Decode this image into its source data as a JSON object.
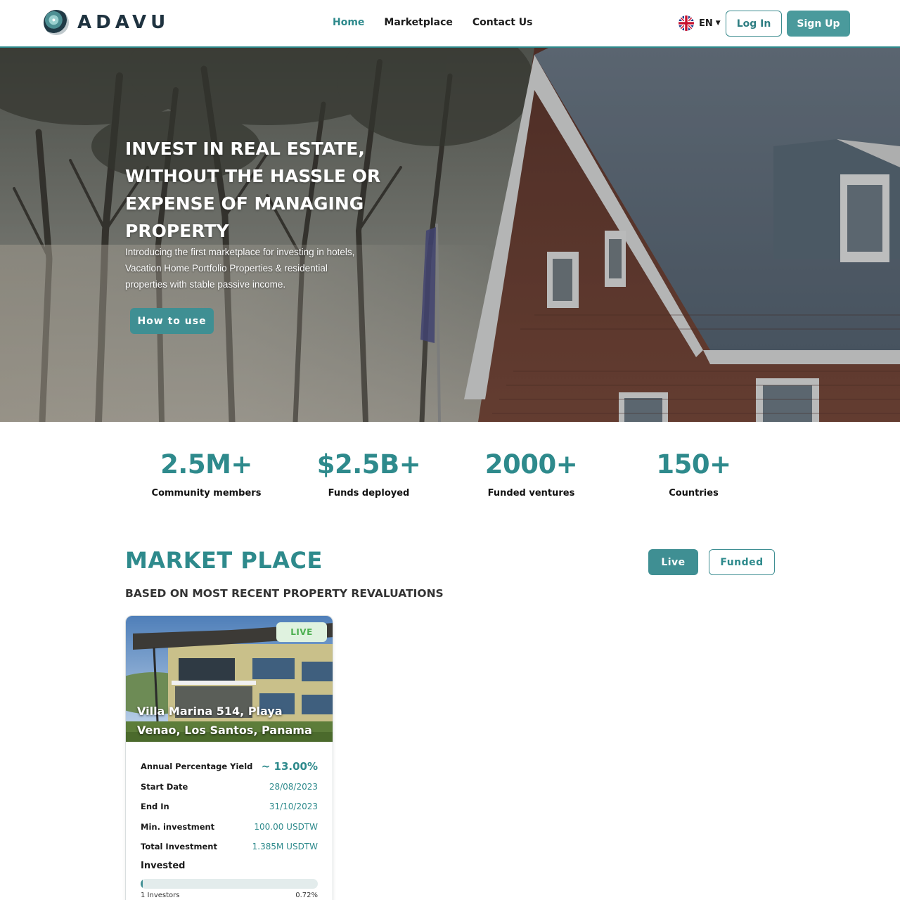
{
  "header": {
    "logo_text": "ADAVU",
    "nav": [
      {
        "label": "Home",
        "active": true
      },
      {
        "label": "Marketplace",
        "active": false
      },
      {
        "label": "Contact Us",
        "active": false
      }
    ],
    "language": "EN",
    "login_label": "Log In",
    "signup_label": "Sign Up"
  },
  "hero": {
    "title": "INVEST IN REAL ESTATE, WITHOUT THE HASSLE OR EXPENSE OF MANAGING PROPERTY",
    "subtitle": "Introducing the first marketplace for investing in hotels, Vacation Home Portfolio Properties & residential properties with stable passive income.",
    "cta_label": "How to use"
  },
  "stats": [
    {
      "value": "2.5M+",
      "label": "Community members"
    },
    {
      "value": "$2.5B+",
      "label": "Funds deployed"
    },
    {
      "value": "2000+",
      "label": "Funded ventures"
    },
    {
      "value": "150+",
      "label": "Countries"
    }
  ],
  "marketplace": {
    "title": "MARKET PLACE",
    "subtitle": "BASED ON MOST RECENT PROPERTY REVALUATIONS",
    "tabs": {
      "live": "Live",
      "funded": "Funded"
    },
    "card": {
      "badge": "LIVE",
      "name": "Villa Marina 514, Playa Venao, Los Santos, Panama",
      "rows": [
        {
          "label": "Annual Percentage Yield",
          "value": "~ 13.00%"
        },
        {
          "label": "Start Date",
          "value": "28/08/2023"
        },
        {
          "label": "End In",
          "value": "31/10/2023"
        },
        {
          "label": "Min. investment",
          "value": "100.00 USDTW"
        },
        {
          "label": "Total Investment",
          "value": "1.385M USDTW"
        }
      ],
      "invested_label": "Invested",
      "progress_percent": 0.72,
      "investors": "1 Investors",
      "invested_percent": "0.72%"
    }
  },
  "colors": {
    "accent": "#2e8a8c",
    "button": "#3f8f93",
    "live_badge_bg": "#dff2df",
    "live_badge_text": "#4caf50"
  }
}
